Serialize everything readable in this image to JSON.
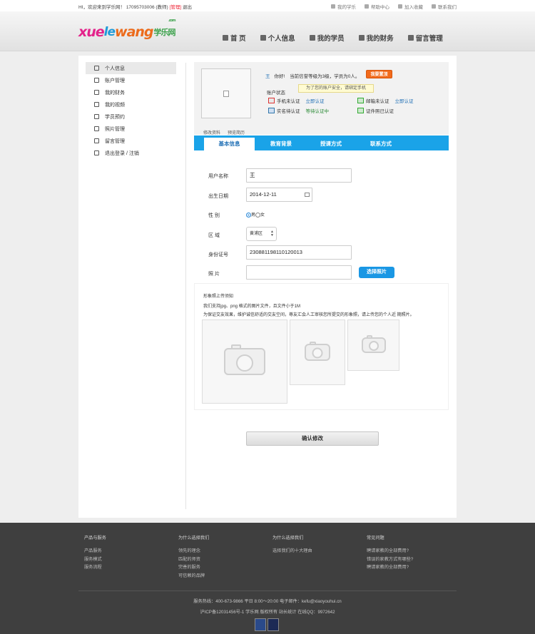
{
  "topbar": {
    "welcome": "HI，欢迎来到学乐网！",
    "phone": "17095703006",
    "role": "(教师)",
    "admin": "[管理]",
    "logout": "退出",
    "links": [
      {
        "label": "我的学乐",
        "icon": "heart-icon"
      },
      {
        "label": "帮助中心",
        "icon": "help-icon"
      },
      {
        "label": "加入收藏",
        "icon": "bookmark-icon"
      },
      {
        "label": "联系我们",
        "icon": "phone-icon"
      }
    ]
  },
  "logo": {
    "part1": "xue",
    "part2": "le",
    "part3": "wang",
    "cn": "学乐网",
    "domain": ".com"
  },
  "nav": [
    {
      "label": "首 页",
      "icon": "home-icon"
    },
    {
      "label": "个人信息",
      "icon": "user-icon"
    },
    {
      "label": "我的学员",
      "icon": "users-icon"
    },
    {
      "label": "我的财务",
      "icon": "edit-icon"
    },
    {
      "label": "留言管理",
      "icon": "message-icon"
    }
  ],
  "sidebar": {
    "items": [
      {
        "label": "个人信息",
        "icon": "user-icon",
        "active": true
      },
      {
        "label": "账户管理",
        "icon": "account-icon",
        "active": false
      },
      {
        "label": "我的财务",
        "icon": "pencil-icon",
        "active": false
      },
      {
        "label": "我的视频",
        "icon": "video-icon",
        "active": false
      },
      {
        "label": "学员预约",
        "icon": "students-icon",
        "active": false
      },
      {
        "label": "照片管理",
        "icon": "photo-icon",
        "active": false
      },
      {
        "label": "留言管理",
        "icon": "envelope-icon",
        "active": false
      },
      {
        "label": "退出登录 / 注销",
        "icon": "logout-icon",
        "active": false
      }
    ]
  },
  "profile": {
    "edit_profile": "修改资料",
    "preview_resume": "预览简历",
    "username": "王",
    "greeting": "你好!",
    "level_text": "当前信誉等级为3级，学员为0人。",
    "upgrade_btn": "我要置顶",
    "account_status": "账户状态",
    "tooltip": "为了您的账户安全，请绑定手机",
    "verifications": [
      {
        "label": "手机未认证",
        "action": "立即认证"
      },
      {
        "label": "邮箱未认证",
        "action": "立即认证"
      },
      {
        "label": "实名待认证",
        "action": "等待认证中"
      },
      {
        "label": "证件照已认证",
        "action": ""
      }
    ]
  },
  "tabs": [
    {
      "label": "基本信息",
      "active": true
    },
    {
      "label": "教育背景",
      "active": false
    },
    {
      "label": "授课方式",
      "active": false
    },
    {
      "label": "联系方式",
      "active": false
    }
  ],
  "form": {
    "name_label": "用户名称",
    "name_value": "王",
    "birth_label": "出生日期",
    "birth_value": "2014-12-11",
    "gender_label": "性 别",
    "gender_male": "男",
    "gender_female": "女",
    "region_label": "区 域",
    "region_value": "黄浦区",
    "id_label": "身份证号",
    "id_value": "230881198110120013",
    "photo_label": "照 片",
    "choose_photo": "选择照片"
  },
  "upload": {
    "title": "形象照上传须知",
    "note1": "我们支持jpg、png 格式的图片文件，且文件小于1M",
    "note2": "为保证交友效果，维护诚信舒适的交友空间，尊友汇会人工审核您所提交的形象照，请上传您的个人近 期照片。"
  },
  "confirm_btn": "确认修改",
  "footer": {
    "columns": [
      {
        "heading": "产品与服务",
        "links": [
          "产品服务",
          "服务模式",
          "服务流程"
        ]
      },
      {
        "heading": "为什么选择我们",
        "links": [
          "领先的理念",
          "匹配的师资",
          "完善的服务",
          "可信赖的品牌"
        ]
      },
      {
        "heading": "为什么选择我们",
        "links": [
          "选择我们的十大理由"
        ]
      },
      {
        "heading": "常见问题",
        "links": [
          "聘请家教的全部费用?",
          "错误的家教方式有哪些?",
          "聘请家教的全部费用?"
        ]
      }
    ],
    "service_line": "服务热线：400-673-9866    平日 8:00～20:00 电子邮件：kefu@xiaoyouhui.cn",
    "icp_line": "沪ICP备12031456号-1    学乐网    版权所有    站长统计    在线QQ：9972642"
  }
}
